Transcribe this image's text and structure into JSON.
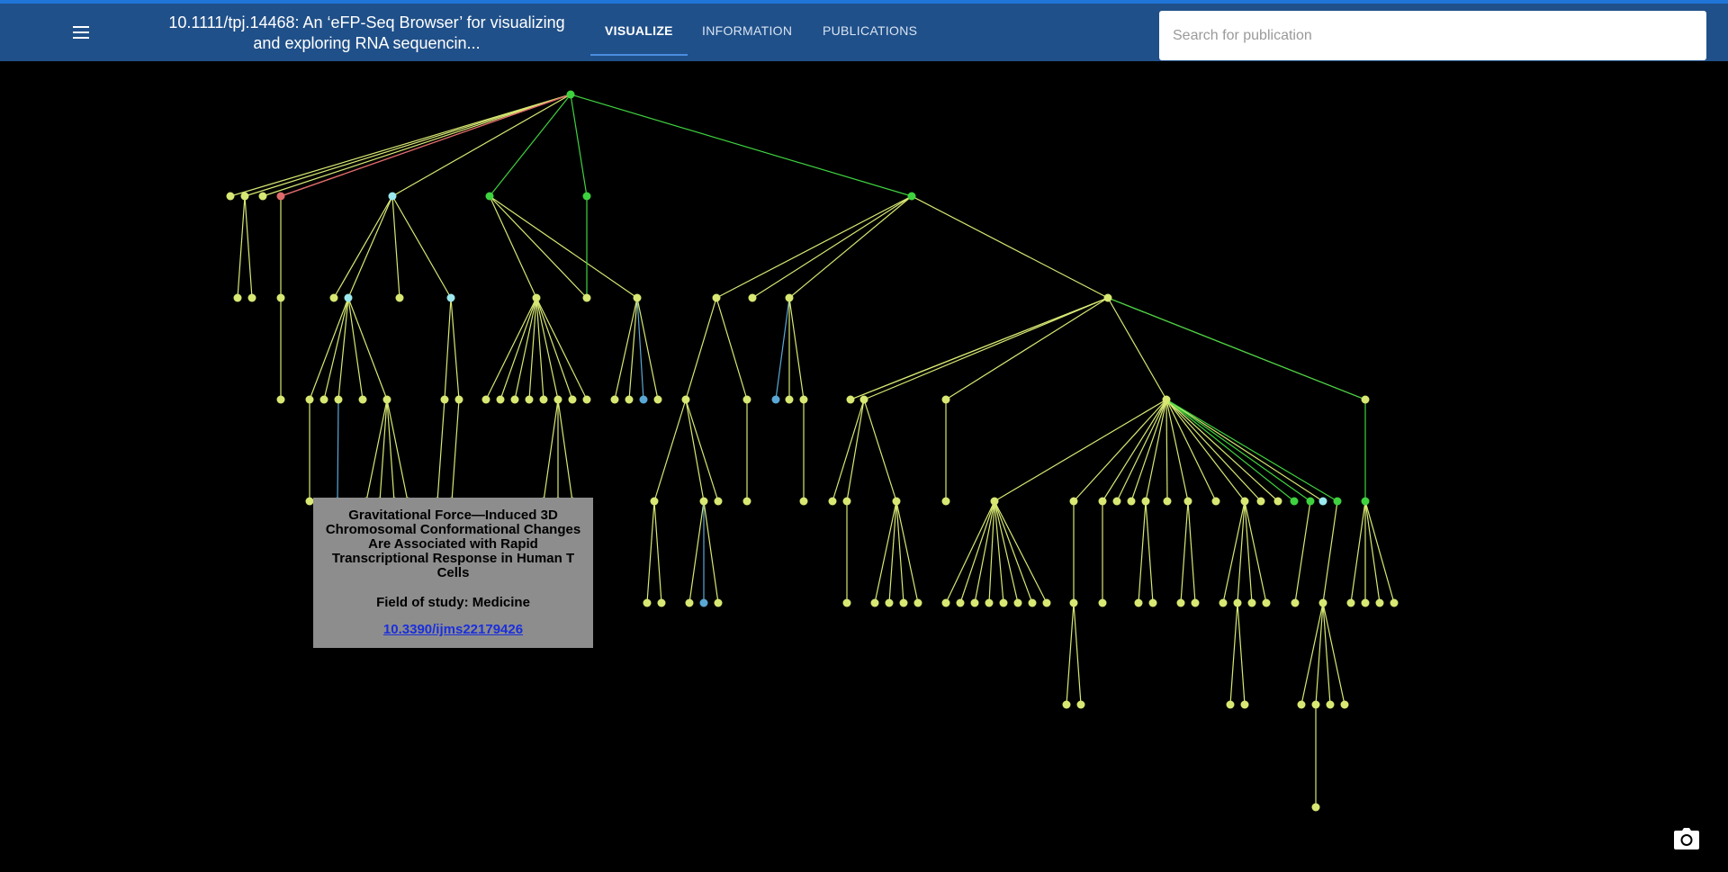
{
  "header": {
    "title": "10.1111/tpj.14468: An ‘eFP-Seq Browser’ for visualizing and exploring RNA sequencin...",
    "menu_icon": "hamburger-menu-icon",
    "tabs": [
      {
        "label": "VISUALIZE",
        "active": true
      },
      {
        "label": "INFORMATION",
        "active": false
      },
      {
        "label": "PUBLICATIONS",
        "active": false
      }
    ],
    "search_placeholder": "Search for publication",
    "accent_color": "#205089"
  },
  "tooltip": {
    "title": "Gravitational Force—Induced 3D Chromosomal Conformational Changes Are Associated with Rapid Transcriptional Response in Human T Cells",
    "field": "Field of study: Medicine",
    "link": "10.3390/ijms22179426"
  },
  "colors": {
    "node_default": "#d8e873",
    "node_green": "#3fd23f",
    "node_cyan": "#9be8ee",
    "node_blue": "#5aa8d6",
    "node_red": "#e06b6b",
    "edge_default": "#d8e873"
  },
  "screenshot_icon": "camera-icon"
}
